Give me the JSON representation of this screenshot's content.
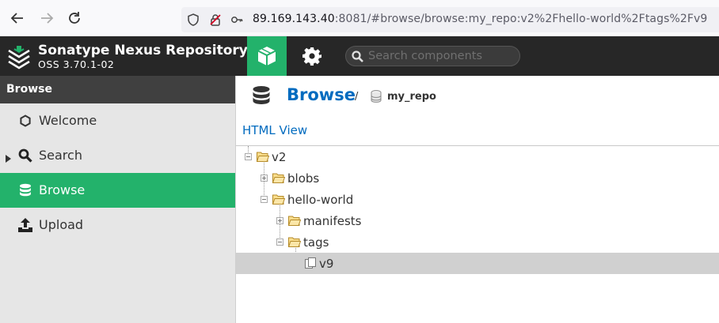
{
  "browser": {
    "url_host": "89.169.143.40",
    "url_rest": ":8081/#browse/browse:my_repo:v2%2Fhello-world%2Ftags%2Fv9"
  },
  "header": {
    "brand_title": "Sonatype Nexus Repository",
    "brand_version": "OSS 3.70.1-02",
    "search_placeholder": "Search components",
    "accent_color": "#23b26b"
  },
  "sidebar": {
    "title": "Browse",
    "items": [
      {
        "label": "Welcome",
        "icon": "hexagon-icon"
      },
      {
        "label": "Search",
        "icon": "search-icon"
      },
      {
        "label": "Browse",
        "icon": "database-icon",
        "active": true
      },
      {
        "label": "Upload",
        "icon": "upload-icon"
      }
    ]
  },
  "main": {
    "breadcrumb_title": "Browse",
    "breadcrumb_separator": "/",
    "breadcrumb_repo": "my_repo",
    "html_view_label": "HTML View",
    "tree": [
      {
        "label": "v2",
        "depth": 0,
        "expanded": true
      },
      {
        "label": "blobs",
        "depth": 1,
        "expanded": false
      },
      {
        "label": "hello-world",
        "depth": 1,
        "expanded": true
      },
      {
        "label": "manifests",
        "depth": 2,
        "expanded": false
      },
      {
        "label": "tags",
        "depth": 2,
        "expanded": true
      },
      {
        "label": "v9",
        "depth": 3,
        "leaf": true,
        "selected": true
      }
    ]
  }
}
